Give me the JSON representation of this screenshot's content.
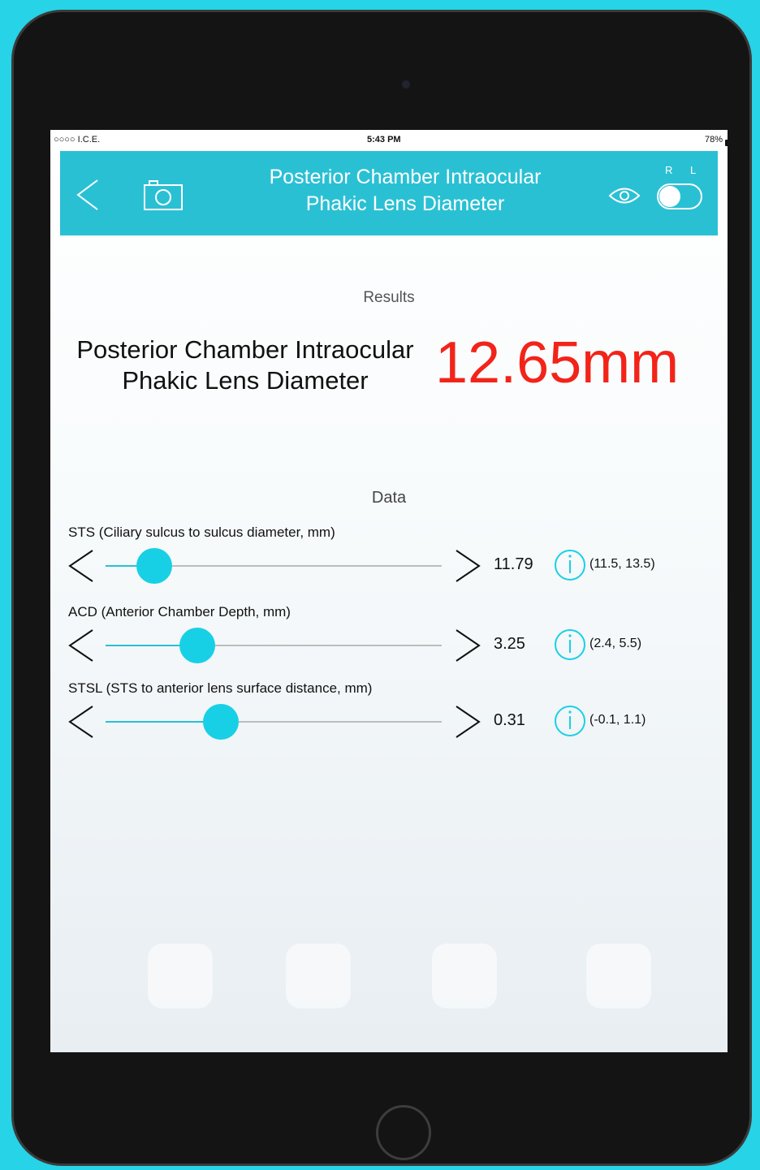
{
  "status_bar": {
    "carrier": "○○○○ I.C.E.",
    "time": "5:43 PM",
    "battery": "78%"
  },
  "nav": {
    "title_line1": "Posterior Chamber Intraocular",
    "title_line2": "Phakic Lens Diameter",
    "eye_r_label": "R",
    "eye_l_label": "L"
  },
  "results": {
    "title": "Results",
    "label_line1": "Posterior Chamber Intraocular",
    "label_line2": "Phakic Lens Diameter",
    "value": "12.65mm"
  },
  "data": {
    "title": "Data",
    "params": [
      {
        "label": "STS (Ciliary sulcus to sulcus diameter, mm)",
        "value": "11.79",
        "range": "(11.5, 13.5)",
        "level": 0.145
      },
      {
        "label": "ACD (Anterior Chamber Depth, mm)",
        "value": "3.25",
        "range": "(2.4, 5.5)",
        "level": 0.274
      },
      {
        "label": "STSL (STS to anterior lens surface distance, mm)",
        "value": "0.31",
        "range": "(-0.1, 1.1)",
        "level": 0.342
      }
    ]
  },
  "colors": {
    "accent": "#2ac0d4",
    "result": "#f2241a",
    "slider": "#18d0e6"
  },
  "icons": {
    "back": "chevron-left-icon",
    "camera": "camera-icon",
    "eye": "eye-icon",
    "info": "info-icon",
    "decrement": "chevron-left-icon",
    "increment": "chevron-right-icon"
  }
}
